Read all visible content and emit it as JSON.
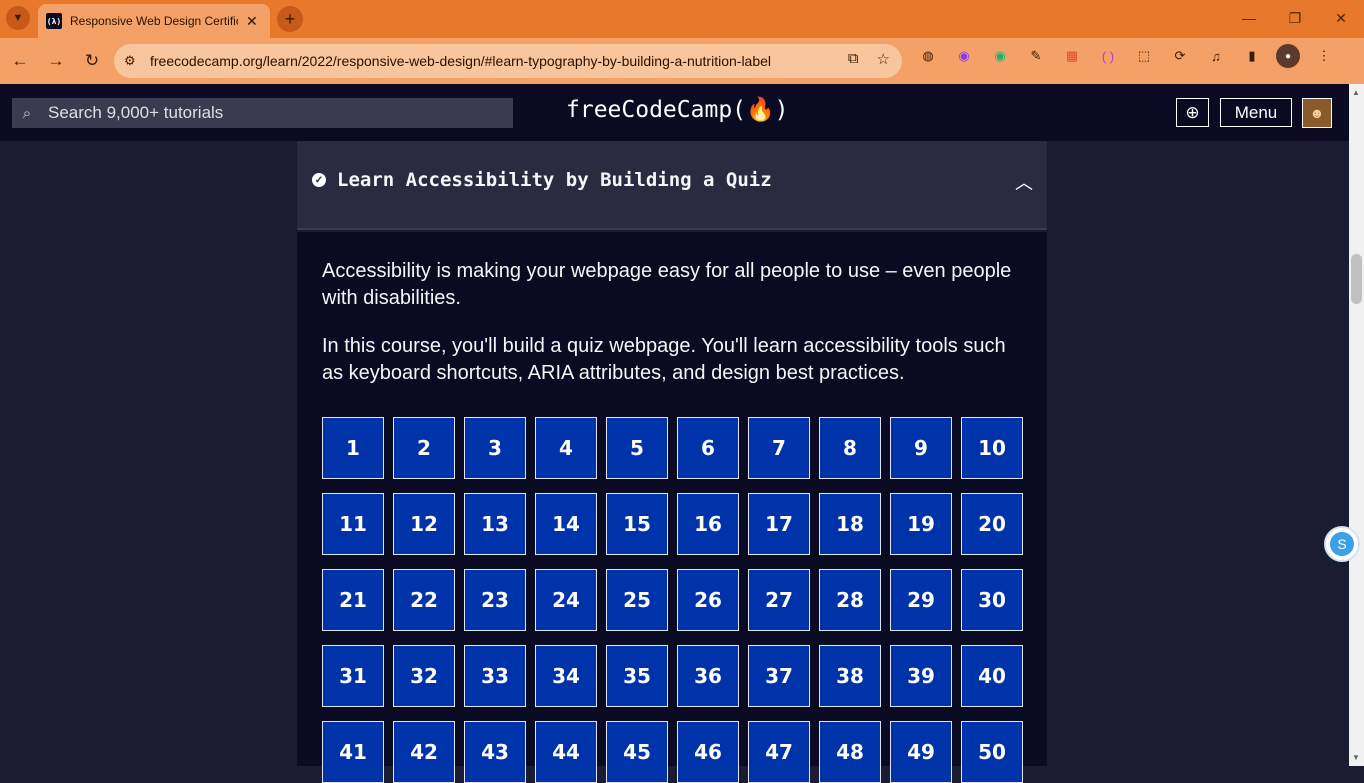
{
  "browser": {
    "tab_title": "Responsive Web Design Certification",
    "favicon_text": "(λ)",
    "url": "freecodecamp.org/learn/2022/responsive-web-design/#learn-typography-by-building-a-nutrition-label",
    "theme_color": "#e8782c"
  },
  "navbar": {
    "search_placeholder": "Search 9,000+ tutorials",
    "brand": "freeCodeCamp(🔥)",
    "menu_label": "Menu"
  },
  "block": {
    "title": "Learn Accessibility by Building a Quiz",
    "description_1": "Accessibility is making your webpage easy for all people to use – even people with disabilities.",
    "description_2": "In this course, you'll build a quiz webpage. You'll learn accessibility tools such as keyboard shortcuts, ARIA attributes, and design best practices.",
    "steps": [
      "1",
      "2",
      "3",
      "4",
      "5",
      "6",
      "7",
      "8",
      "9",
      "10",
      "11",
      "12",
      "13",
      "14",
      "15",
      "16",
      "17",
      "18",
      "19",
      "20",
      "21",
      "22",
      "23",
      "24",
      "25",
      "26",
      "27",
      "28",
      "29",
      "30",
      "31",
      "32",
      "33",
      "34",
      "35",
      "36",
      "37",
      "38",
      "39",
      "40",
      "41",
      "42",
      "43",
      "44",
      "45",
      "46",
      "47",
      "48",
      "49",
      "50"
    ]
  },
  "colors": {
    "step_bg": "#0033aa",
    "page_bg": "#1b1b32",
    "nav_bg": "#0a0a23"
  }
}
